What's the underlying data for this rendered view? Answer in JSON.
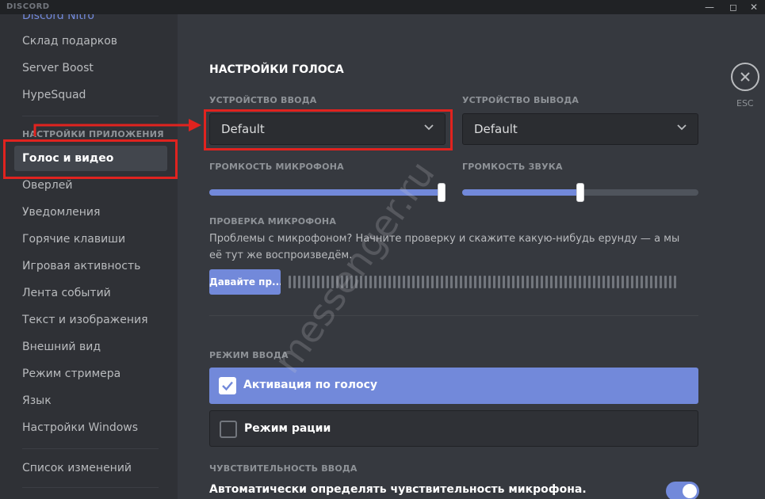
{
  "window": {
    "app_name": "DISCORD",
    "minimize_icon": "minimize-icon",
    "maximize_icon": "maximize-icon",
    "close_icon": "close-icon"
  },
  "sidebar": {
    "top_items": [
      {
        "label": "Discord Nitro"
      },
      {
        "label": "Склад подарков"
      },
      {
        "label": "Server Boost"
      },
      {
        "label": "HypeSquad"
      }
    ],
    "app_settings_header": "НАСТРОЙКИ ПРИЛОЖЕНИЯ",
    "app_items": [
      {
        "label": "Голос и видео",
        "active": true
      },
      {
        "label": "Оверлей"
      },
      {
        "label": "Уведомления"
      },
      {
        "label": "Горячие клавиши"
      },
      {
        "label": "Игровая активность"
      },
      {
        "label": "Лента событий"
      },
      {
        "label": "Текст и изображения"
      },
      {
        "label": "Внешний вид"
      },
      {
        "label": "Режим стримера"
      },
      {
        "label": "Язык"
      },
      {
        "label": "Настройки Windows"
      }
    ],
    "changelog": "Список изменений"
  },
  "main": {
    "title": "НАСТРОЙКИ ГОЛОСА",
    "input_device": {
      "label": "УСТРОЙСТВО ВВОДА",
      "value": "Default"
    },
    "output_device": {
      "label": "УСТРОЙСТВО ВЫВОДА",
      "value": "Default"
    },
    "mic_volume": {
      "label": "ГРОМКОСТЬ МИКРОФОНА",
      "level": 1.0
    },
    "sound_volume": {
      "label": "ГРОМКОСТЬ ЗВУКА",
      "level": 0.5
    },
    "mic_test": {
      "label": "ПРОВЕРКА МИКРОФОНА",
      "description": "Проблемы с микрофоном? Начните проверку и скажите какую-нибудь ерунду — а мы её тут же воспроизведём.",
      "button": "Давайте пр..."
    },
    "input_mode": {
      "label": "РЕЖИМ ВВОДА",
      "voice_activity": "Активация по голосу",
      "push_to_talk": "Режим рации",
      "selected": "voice_activity"
    },
    "sensitivity": {
      "label": "ЧУВСТВИТЕЛЬНОСТЬ ВВОДА",
      "auto_label": "Автоматически определять чувствительность микрофона.",
      "auto_enabled": true
    },
    "close": {
      "esc_label": "ESC"
    }
  },
  "watermark": "messenger.ru",
  "colors": {
    "accent": "#7289da",
    "annotation": "#e0231f",
    "background": "#36393f",
    "sidebar": "#2f3136"
  }
}
